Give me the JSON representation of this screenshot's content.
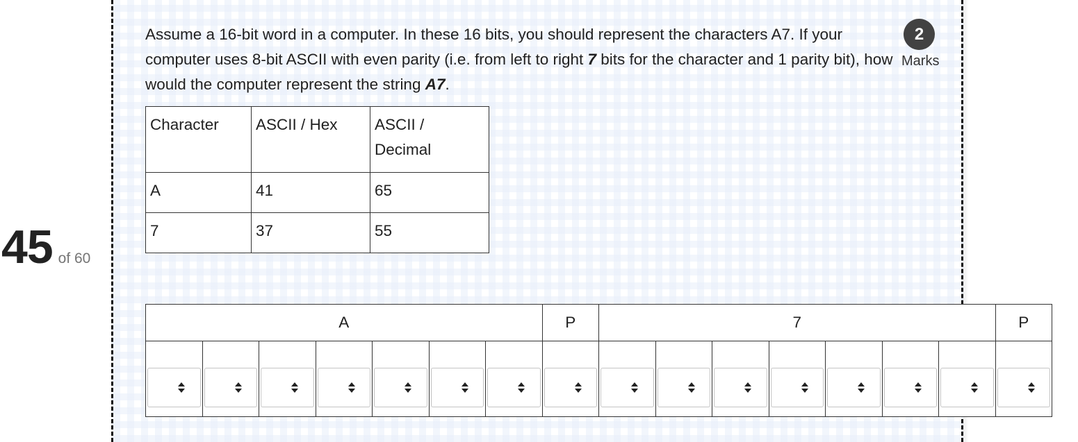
{
  "question": {
    "number": "45",
    "of_total": "of 60",
    "marks_value": "2",
    "marks_label": "Marks",
    "prompt": {
      "part1": "Assume a 16-bit word in a computer. In these 16 bits, you should represent the characters A7. If your computer uses 8-bit ASCII with even parity (i.e. from left to right ",
      "em1": "7",
      "part2": " bits for the character and 1 parity bit), how would the computer represent the string ",
      "em2": "A7",
      "part3": "."
    }
  },
  "reference_table": {
    "headers": [
      "Character",
      "ASCII / Hex",
      "ASCII / Decimal"
    ],
    "rows": [
      [
        "A",
        "41",
        "65"
      ],
      [
        "7",
        "37",
        "55"
      ]
    ]
  },
  "answer_grid": {
    "groups": [
      {
        "label": "A",
        "span": 7
      },
      {
        "label": "P",
        "span": 1
      },
      {
        "label": "7",
        "span": 7
      },
      {
        "label": "P",
        "span": 1
      }
    ],
    "selects": [
      "",
      "",
      "",
      "",
      "",
      "",
      "",
      "",
      "",
      "",
      "",
      "",
      "",
      "",
      "",
      ""
    ]
  },
  "colors": {
    "badge": "#424242",
    "border": "#333333",
    "watermark": "#e8eefa"
  },
  "icons": {
    "select_arrow": "up-down-caret-icon"
  }
}
